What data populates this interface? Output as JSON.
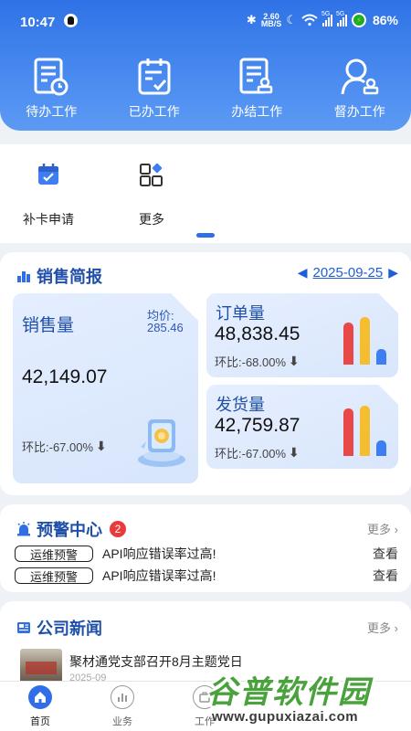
{
  "status_bar": {
    "time": "10:47",
    "network_speed_value": "2.60",
    "network_speed_unit": "MB/S",
    "signal_1_label": "5G",
    "signal_2_label": "5G",
    "battery": "86%"
  },
  "work_items": [
    {
      "label": "待办工作",
      "icon": "pending-doc-icon"
    },
    {
      "label": "已办工作",
      "icon": "done-clipboard-icon"
    },
    {
      "label": "办结工作",
      "icon": "closed-stamp-icon"
    },
    {
      "label": "督办工作",
      "icon": "supervise-user-icon"
    }
  ],
  "quick_actions": [
    {
      "label": "补卡申请",
      "icon": "calendar-check-icon"
    },
    {
      "label": "更多",
      "icon": "grid-more-icon"
    }
  ],
  "sales": {
    "title": "销售简报",
    "date": "2025-09-25",
    "sales_volume": {
      "label": "销售量",
      "value": "42,149.07",
      "ratio": "环比:-67.00%",
      "avg_label": "均价:",
      "avg_value": "285.46"
    },
    "orders": {
      "label": "订单量",
      "value": "48,838.45",
      "ratio": "环比:-68.00%",
      "bars": [
        0.8,
        0.9,
        0.3
      ]
    },
    "shipments": {
      "label": "发货量",
      "value": "42,759.87",
      "ratio": "环比:-67.00%",
      "bars": [
        0.9,
        0.95,
        0.3
      ]
    }
  },
  "alerts": {
    "title": "预警中心",
    "count": "2",
    "more": "更多",
    "items": [
      {
        "tag": "运维预警",
        "message": "API响应错误率过高!",
        "action": "查看"
      },
      {
        "tag": "运维预警",
        "message": "API响应错误率过高!",
        "action": "查看"
      }
    ]
  },
  "news": {
    "title": "公司新闻",
    "more": "更多",
    "item_title": "聚材通党支部召开8月主题党日",
    "item_sub": "2025-09"
  },
  "tabbar": [
    {
      "label": "首页",
      "active": true
    },
    {
      "label": "业务",
      "active": false
    },
    {
      "label": "工作",
      "active": false
    }
  ],
  "watermark": {
    "brand": "谷普软件园",
    "url": "www.gupuxiazai.com"
  },
  "colors": {
    "primary": "#2f6ee6",
    "bar_red": "#e84848",
    "bar_yellow": "#f5bd30",
    "bar_blue": "#3f7ef0",
    "badge": "#e83b3b"
  }
}
